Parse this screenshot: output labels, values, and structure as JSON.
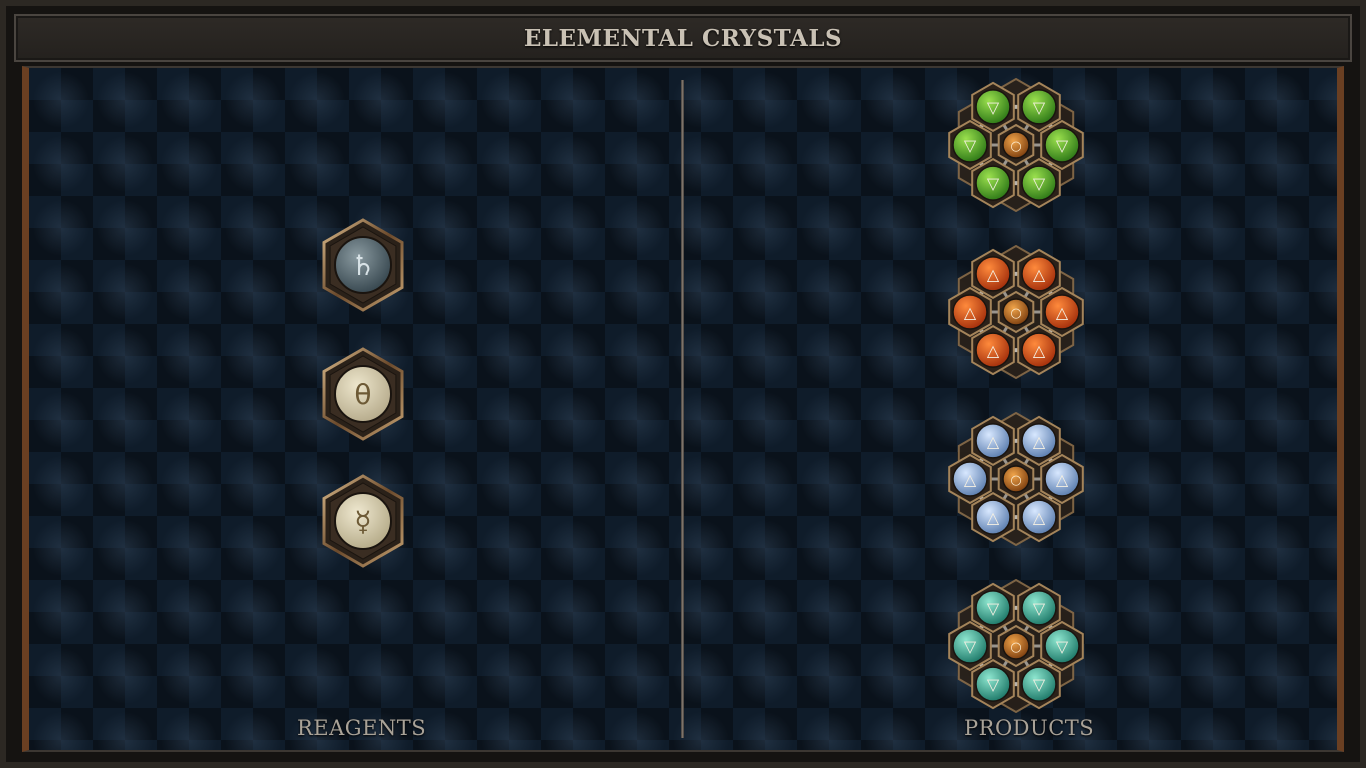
{
  "window": {
    "title": "ELEMENTAL CRYSTALS"
  },
  "reagents": {
    "label": "REAGENTS",
    "items": [
      {
        "symbol": "♄",
        "name": "saturn-reagent-icon",
        "orb": "#3a4a52",
        "orb_light": "#8a9aa0",
        "glyph_color": "#d8e2e6"
      },
      {
        "symbol": "θ",
        "name": "salt-reagent-icon",
        "orb": "#b8ad8e",
        "orb_light": "#ede6cc",
        "glyph_color": "#6d5a36"
      },
      {
        "symbol": "☿",
        "name": "mercury-reagent-icon",
        "orb": "#b7ad8b",
        "orb_light": "#efe8d0",
        "glyph_color": "#6d5a36"
      }
    ]
  },
  "products": {
    "label": "PRODUCTS",
    "items": [
      {
        "name": "earth-crystal-molecule-icon",
        "orb": "#2f7a18",
        "orb_light": "#9be04e",
        "glyph": "▽"
      },
      {
        "name": "fire-crystal-molecule-icon",
        "orb": "#a5300c",
        "orb_light": "#ff8a3c",
        "glyph": "△"
      },
      {
        "name": "air-crystal-molecule-icon",
        "orb": "#5d7fb0",
        "orb_light": "#d8e8ff",
        "glyph": "△"
      },
      {
        "name": "water-crystal-molecule-icon",
        "orb": "#1f7a6a",
        "orb_light": "#8ee6cf",
        "glyph": "▽"
      }
    ],
    "center_glyph": "○"
  }
}
